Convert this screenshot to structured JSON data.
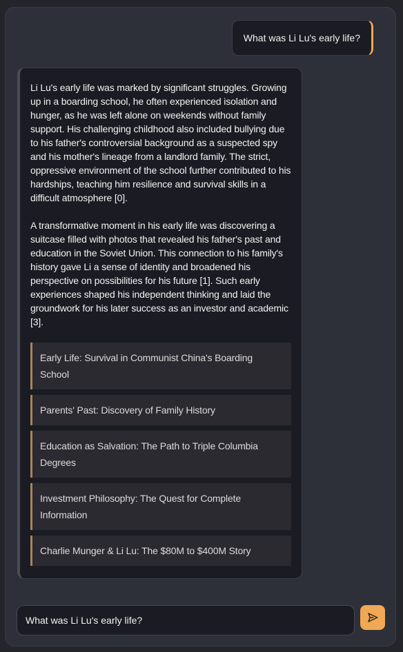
{
  "conversation": {
    "user_message": "What was Li Lu's early life?",
    "assistant_paragraphs": [
      "Li Lu's early life was marked by significant struggles. Growing up in a boarding school, he often experienced isolation and hunger, as he was left alone on weekends without family support. His challenging childhood also included bullying due to his father's controversial background as a suspected spy and his mother's lineage from a landlord family. The strict, oppressive environment of the school further contributed to his hardships, teaching him resilience and survival skills in a difficult atmosphere [0].",
      "A transformative moment in his early life was discovering a suitcase filled with photos that revealed his father's past and education in the Soviet Union. This connection to his family's history gave Li a sense of identity and broadened his perspective on possibilities for his future [1]. Such early experiences shaped his independent thinking and laid the groundwork for his later success as an investor and academic [3]."
    ],
    "sources": [
      "Early Life: Survival in Communist China's Boarding School",
      "Parents' Past: Discovery of Family History",
      "Education as Salvation: The Path to Triple Columbia Degrees",
      "Investment Philosophy: The Quest for Complete Information",
      "Charlie Munger & Li Lu: The $80M to $400M Story"
    ]
  },
  "composer": {
    "input_value": "What was Li Lu's early life?",
    "send_icon": "send-icon"
  },
  "colors": {
    "accent": "#f0a855",
    "background": "#23252b",
    "panel": "#2d3038",
    "bubble": "#1b1c23",
    "source_border": "#a8855a"
  }
}
